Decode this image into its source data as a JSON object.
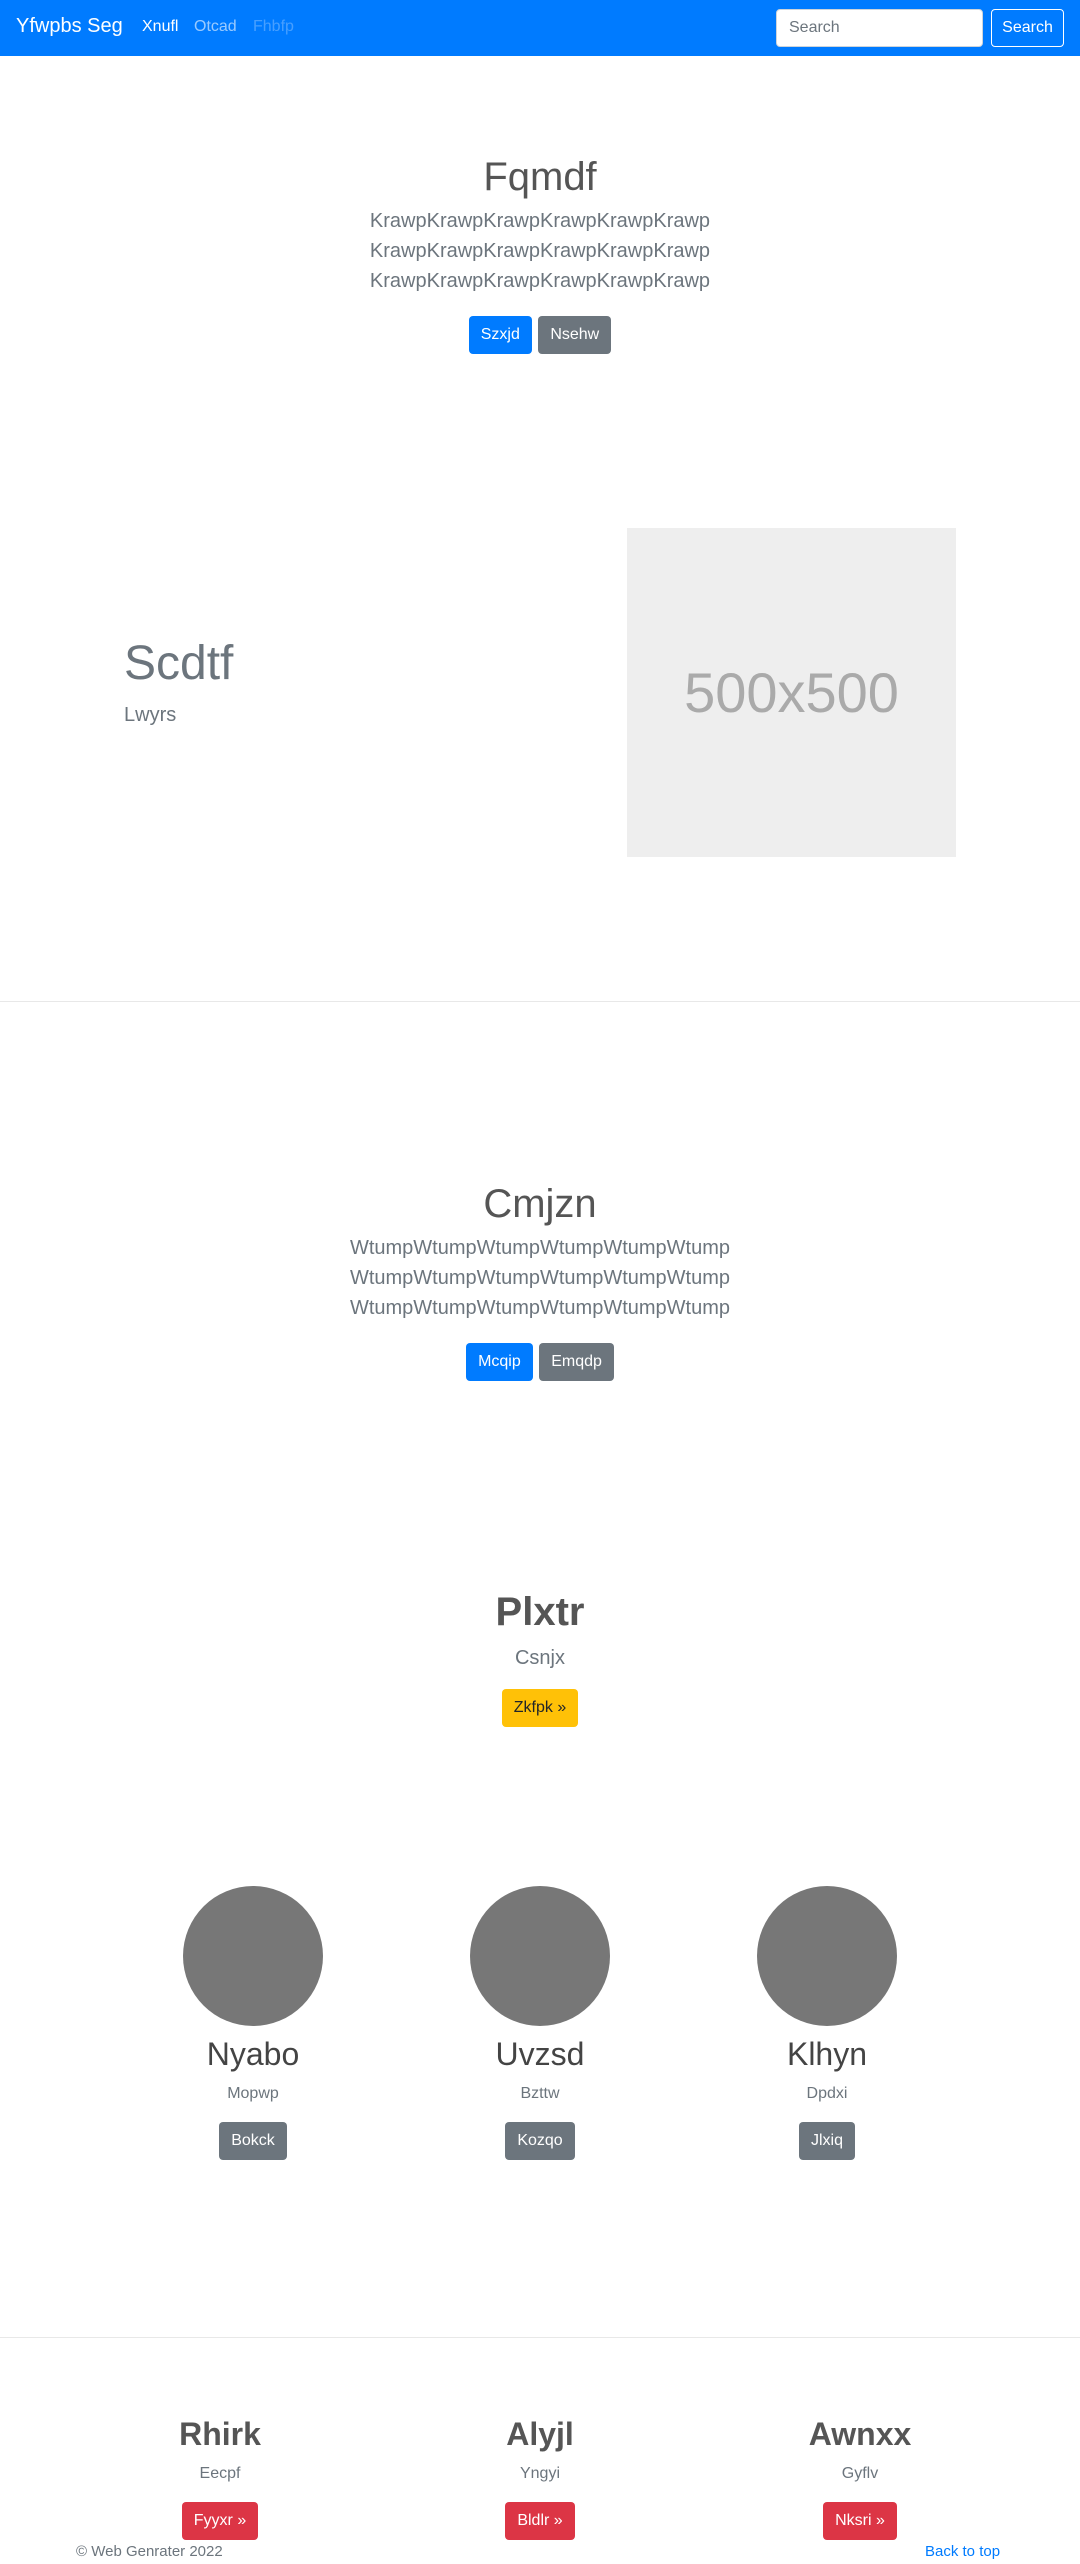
{
  "navbar": {
    "brand": "Yfwpbs Seg",
    "links": [
      "Xnufl",
      "Otcad",
      "Fhbfp"
    ],
    "search_placeholder": "Search",
    "search_button": "Search",
    "bg_color": "#007bff"
  },
  "hero": {
    "title": "Fqmdf",
    "lines": [
      "KrawpKrawpKrawpKrawpKrawpKrawp",
      "KrawpKrawpKrawpKrawpKrawpKrawp",
      "KrawpKrawpKrawpKrawpKrawpKrawp"
    ],
    "primary_button": "Szxjd",
    "secondary_button": "Nsehw"
  },
  "feature": {
    "heading": "Scdtf",
    "subheading": "Lwyrs",
    "image_label": "500x500"
  },
  "hero2": {
    "title": "Cmjzn",
    "lines": [
      "WtumpWtumpWtumpWtumpWtumpWtump",
      "WtumpWtumpWtumpWtumpWtumpWtump",
      "WtumpWtumpWtumpWtumpWtumpWtump"
    ],
    "primary_button": "Mcqip",
    "secondary_button": "Emqdp"
  },
  "cta": {
    "title": "Plxtr",
    "subtitle": "Csnjx",
    "button": "Zkfpk »"
  },
  "team": [
    {
      "name": "Nyabo",
      "role": "Mopwp",
      "button": "Bokck"
    },
    {
      "name": "Uvzsd",
      "role": "Bzttw",
      "button": "Kozqo"
    },
    {
      "name": "Klhyn",
      "role": "Dpdxi",
      "button": "Jlxiq"
    }
  ],
  "columns": [
    {
      "title": "Rhirk",
      "subtitle": "Eecpf",
      "button": "Fyyxr »"
    },
    {
      "title": "Alyjl",
      "subtitle": "Yngyi",
      "button": "Bldlr »"
    },
    {
      "title": "Awnxx",
      "subtitle": "Gyflv",
      "button": "Nksri »"
    }
  ],
  "footer": {
    "copyright": "© Web Genrater 2022",
    "back_to_top": "Back to top"
  }
}
